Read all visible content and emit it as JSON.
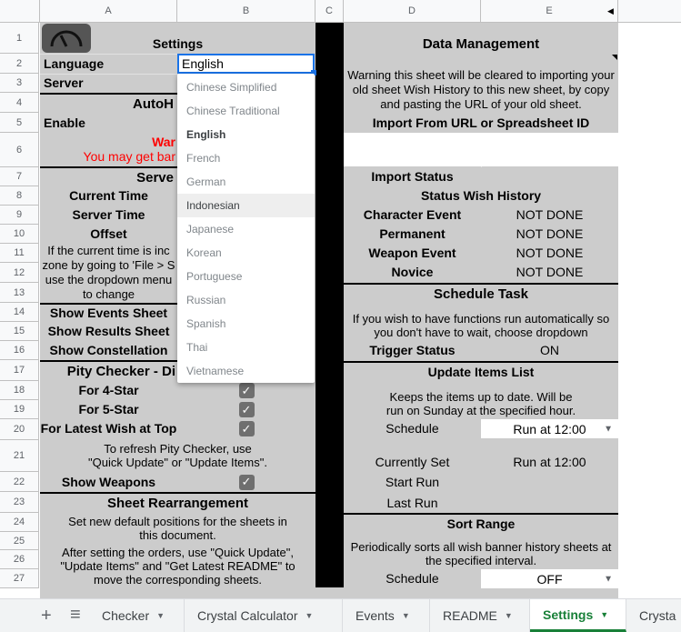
{
  "columns": [
    "",
    "A",
    "B",
    "C",
    "D",
    "E"
  ],
  "rows": [
    "1",
    "2",
    "3",
    "4",
    "5",
    "6",
    "7",
    "8",
    "9",
    "10",
    "11",
    "12",
    "13",
    "14",
    "15",
    "16",
    "17",
    "18",
    "19",
    "20",
    "21",
    "22",
    "23",
    "24",
    "25",
    "26",
    "27"
  ],
  "left": {
    "settings_title": "Settings",
    "language_label": "Language",
    "language_value": "English",
    "server_label": "Server",
    "auto_label": "AutoH",
    "enable_label": "Enable",
    "warn_line1": "War",
    "warn_line2": "You may get bar",
    "server_section": "Serve",
    "current_time": "Current Time",
    "server_time": "Server Time",
    "offset": "Offset",
    "offset_note": "If the current time is inc zone by going to 'File > S use the dropdown menu to change",
    "show_events": "Show Events Sheet",
    "show_results": "Show Results Sheet",
    "show_constellation": "Show Constellation",
    "pity_title": "Pity Checker - Di",
    "for_4star": "For 4-Star",
    "for_5star": "For 5-Star",
    "latest_top": "For Latest Wish at Top",
    "refresh_note": "To refresh Pity Checker, use \"Quick Update\" or \"Update Items\".",
    "show_weapons": "Show Weapons",
    "rearrange_title": "Sheet Rearrangement",
    "rearrange_note1": "Set new default positions for the sheets in this document.",
    "rearrange_note2": "After setting the orders, use \"Quick Update\", \"Update Items\" and \"Get Latest README\" to move the corresponding sheets."
  },
  "language_options": [
    "Chinese Simplified",
    "Chinese Traditional",
    "English",
    "French",
    "German",
    "Indonesian",
    "Japanese",
    "Korean",
    "Portuguese",
    "Russian",
    "Spanish",
    "Thai",
    "Vietnamese"
  ],
  "right": {
    "title": "Data Management",
    "warning": "Warning this sheet will be cleared to importing your old sheet Wish History to this new sheet, by copy and pasting the URL of your old sheet.",
    "import_label": "Import From URL or Spreadsheet ID",
    "import_status": "Import Status",
    "status_wish_history": "Status Wish History",
    "statuses": [
      {
        "label": "Character Event",
        "value": "NOT DONE"
      },
      {
        "label": "Permanent",
        "value": "NOT DONE"
      },
      {
        "label": "Weapon Event",
        "value": "NOT DONE"
      },
      {
        "label": "Novice",
        "value": "NOT DONE"
      }
    ],
    "schedule_task": "Schedule Task",
    "schedule_note": "If you wish to have functions run automatically so you don't have to wait, choose dropdown",
    "trigger_status": "Trigger Status",
    "trigger_value": "ON",
    "update_items": "Update Items List",
    "update_note": "Keeps the items up to date. Will be run on Sunday at the specified hour.",
    "schedule": "Schedule",
    "schedule_value": "Run at 12:00",
    "currently_set": "Currently Set",
    "currently_value": "Run at 12:00",
    "start_run": "Start Run",
    "last_run": "Last Run",
    "sort_range": "Sort Range",
    "sort_note": "Periodically sorts all wish banner history sheets at the specified interval.",
    "schedule2": "Schedule",
    "schedule2_value": "OFF"
  },
  "tabs": {
    "add": "+",
    "list": "≡",
    "items": [
      "Checker",
      "Crystal Calculator",
      "Events",
      "README",
      "Settings",
      "Crysta"
    ],
    "active": "Settings"
  },
  "colors": {
    "cell_gray": "#cccccc",
    "active_tab": "#188038",
    "warning_red": "#ff0000",
    "selection_blue": "#1a73e8"
  }
}
